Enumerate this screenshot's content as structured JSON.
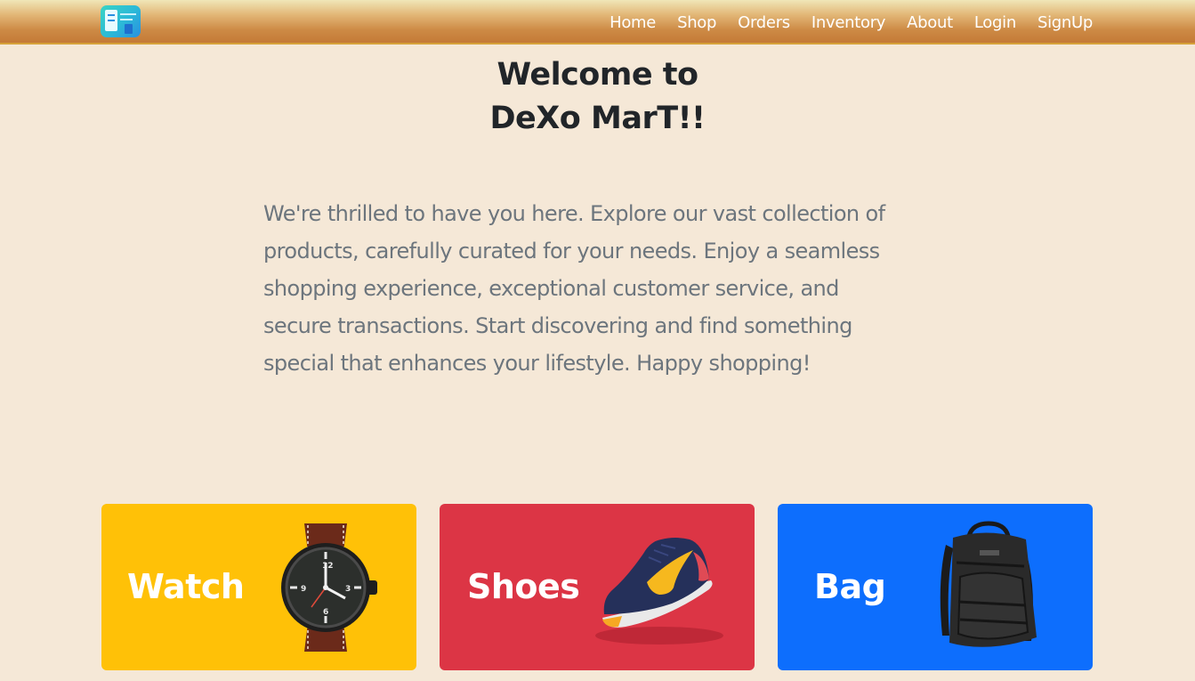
{
  "nav": {
    "logo": "store-logo-icon",
    "links": [
      {
        "label": "Home"
      },
      {
        "label": "Shop"
      },
      {
        "label": "Orders"
      },
      {
        "label": "Inventory"
      },
      {
        "label": "About"
      },
      {
        "label": "Login"
      },
      {
        "label": "SignUp"
      }
    ]
  },
  "hero": {
    "title_line1": "Welcome to",
    "title_line2": "DeXo MarT!!",
    "intro": "We're thrilled to have you here. Explore our vast collection of products, carefully curated for your needs. Enjoy a seamless shopping experience, exceptional customer service, and secure transactions. Start discovering and find something special that enhances your lifestyle. Happy shopping!"
  },
  "categories": [
    {
      "label": "Watch",
      "color": "#ffc107",
      "icon": "wristwatch-icon"
    },
    {
      "label": "Shoes",
      "color": "#dc3545",
      "icon": "sneaker-icon"
    },
    {
      "label": "Bag",
      "color": "#0d6efd",
      "icon": "backpack-icon"
    }
  ],
  "colors": {
    "page_bg": "#f5e8d7",
    "title": "#212529",
    "intro_text": "#6c757d"
  }
}
